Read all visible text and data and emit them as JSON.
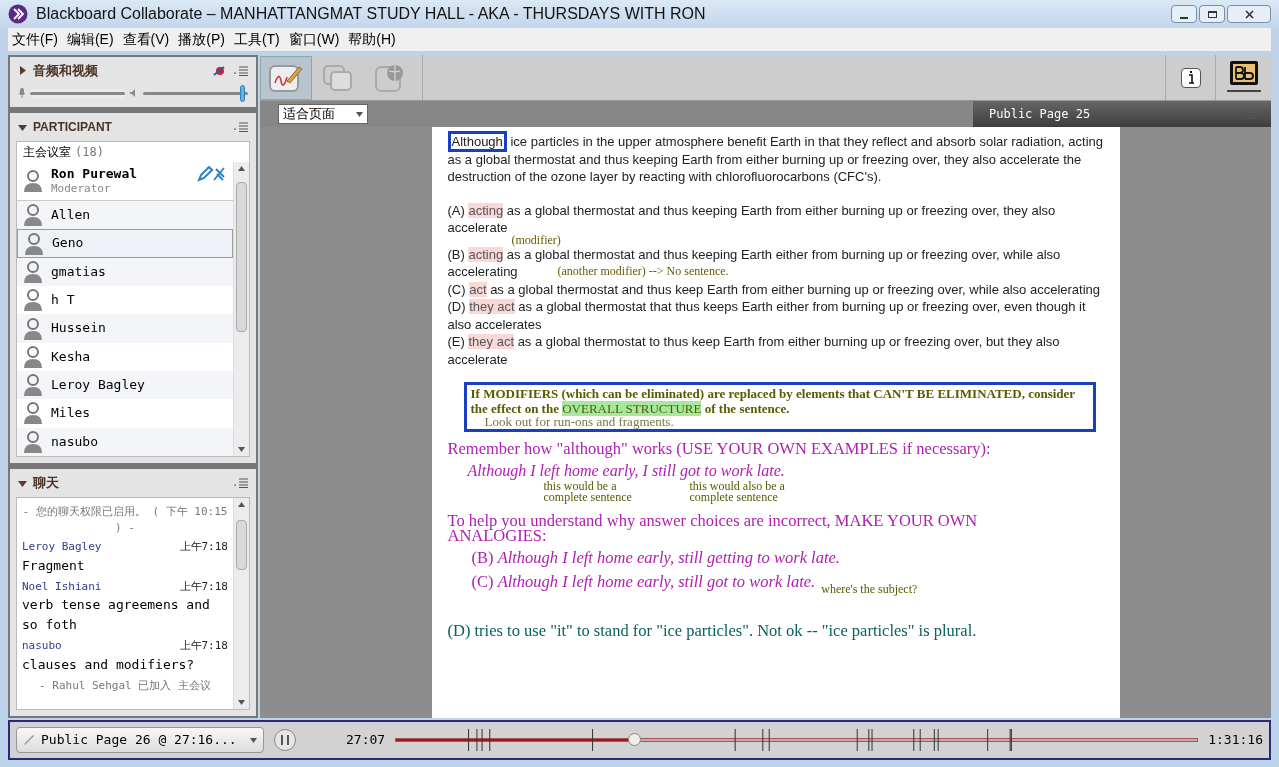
{
  "window": {
    "title": "Blackboard Collaborate – MANHATTANGMAT STUDY HALL - AKA - THURSDAYS WITH RON"
  },
  "menu": [
    "文件(F)",
    "编辑(E)",
    "查看(V)",
    "播放(P)",
    "工具(T)",
    "窗口(W)",
    "帮助(H)"
  ],
  "av_panel": {
    "title": "音频和视频",
    "expanded": false,
    "microphone": {
      "level": 1
    },
    "speaker": {
      "level": 0.95
    }
  },
  "participants": {
    "title": "PARTICIPANT",
    "expanded": true,
    "room": "主会议室",
    "count": "(18)",
    "items": [
      {
        "name": "Ron Purewal",
        "role": "Moderator",
        "selected": false
      },
      {
        "name": "Allen",
        "selected": false
      },
      {
        "name": "Geno",
        "selected": true
      },
      {
        "name": "gmatias",
        "selected": false
      },
      {
        "name": "h T",
        "selected": false
      },
      {
        "name": "Hussein",
        "selected": false
      },
      {
        "name": "Kesha",
        "selected": false
      },
      {
        "name": "Leroy Bagley",
        "selected": false
      },
      {
        "name": "Miles",
        "selected": false
      },
      {
        "name": "nasubo",
        "selected": false
      }
    ]
  },
  "chat": {
    "title": "聊天",
    "expanded": true,
    "messages": [
      {
        "kind": "system",
        "text": "- 您的聊天权限已启用。 ( 下午 10:15 ) -"
      },
      {
        "kind": "message",
        "sender": "Leroy Bagley",
        "time": "上午7:18",
        "text": "Fragment"
      },
      {
        "kind": "message",
        "sender": "Noel Ishiani",
        "time": "上午7:18",
        "text": "verb tense agreemens and so foth"
      },
      {
        "kind": "message",
        "sender": "nasubo",
        "time": "上午7:18",
        "text": "clauses and modifiers?"
      },
      {
        "kind": "system",
        "text": "- Rahul Sehgal 已加入 主会议"
      }
    ]
  },
  "tools": [
    {
      "kind": "whiteboard",
      "selected": true
    },
    {
      "kind": "screens",
      "selected": false
    },
    {
      "kind": "web",
      "selected": false
    }
  ],
  "zoom_select": "适合页面",
  "page_title": "Public Page 25",
  "whiteboard": {
    "question": {
      "lead": "Although",
      "rest": "ice particles in the upper atmosphere benefit Earth in that they reflect and absorb solar radiation, acting as a global thermostat and thus keeping Earth from either burning up or freezing over, they also accelerate the destruction of the ozone layer by reacting with chlorofluorocarbons (CFC's)."
    },
    "choices": [
      {
        "label": "(A)",
        "lead": "acting",
        "rest": "as a global thermostat and thus keeping Earth from either burning up or freezing over, they also accelerate"
      },
      {
        "label": "(B)",
        "lead": "acting",
        "rest": "as a global thermostat and thus keeping Earth either from burning up or freezing over, while also accelerating",
        "notes": [
          "(modifier)",
          "(another modifier)  --> No sentence."
        ]
      },
      {
        "label": "(C)",
        "lead": "act",
        "rest": "as a global thermostat and thus keep Earth from either burning up or freezing over, while also accelerating"
      },
      {
        "label": "(D)",
        "lead": "they act",
        "rest": "as a global thermostat that thus keeps Earth either from burning up or freezing over, even though it also accelerates"
      },
      {
        "label": "(E)",
        "lead": "they act",
        "rest": "as a global thermostat to thus keep Earth from either burning up or freezing over, but they also accelerate"
      }
    ],
    "rule_box": {
      "text": "If MODIFIERS (which can be eliminated) are replaced by elements that CAN'T BE ELIMINATED, consider the effect on the",
      "highlight": "OVERALL STRUCTURE",
      "tail": "of the sentence.",
      "note": "Look out for run-ons and fragments."
    },
    "remember": "Remember how \"although\" works (USE YOUR OWN EXAMPLES if necessary):",
    "example": "Although I left home early, I still got to work late.",
    "example_notes": [
      "this would be a complete sentence",
      "this would also be a complete sentence"
    ],
    "help": "To help you understand why answer choices are incorrect, MAKE YOUR OWN ANALOGIES:",
    "analogies": [
      {
        "label": "(B)",
        "text": "Although I left home early, still getting to work late."
      },
      {
        "label": "(C)",
        "text": "Although I left home early, still got to work late.",
        "note": "where's the subject?"
      }
    ],
    "conclusion": "(D) tries to use \"it\" to stand for \"ice particles\".  Not ok -- \"ice particles\" is plural."
  },
  "playback": {
    "recording": "Public Page 26 @ 27:16...",
    "current": "27:07",
    "total": "1:31:16",
    "level": 0.297,
    "playing": true
  }
}
